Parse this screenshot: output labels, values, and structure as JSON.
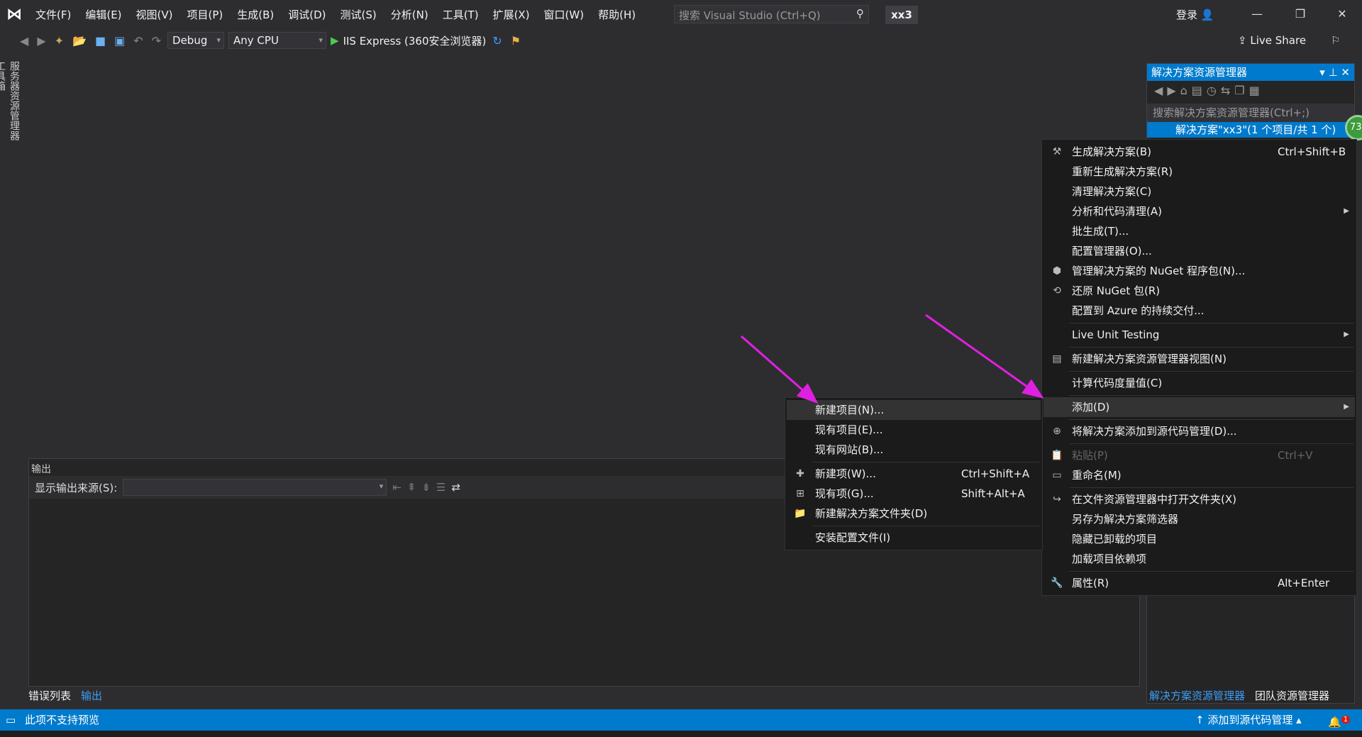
{
  "titlebar": {
    "menus": [
      "文件(F)",
      "编辑(E)",
      "视图(V)",
      "项目(P)",
      "生成(B)",
      "调试(D)",
      "测试(S)",
      "分析(N)",
      "工具(T)",
      "扩展(X)",
      "窗口(W)",
      "帮助(H)"
    ],
    "search_placeholder": "搜索 Visual Studio (Ctrl+Q)",
    "project": "xx3",
    "login": "登录"
  },
  "toolbar": {
    "config": "Debug",
    "platform": "Any CPU",
    "run": "IIS Express (360安全浏览器)",
    "live_share": "Live Share"
  },
  "left_tabs": [
    "服务器资源管理器",
    "工具箱"
  ],
  "solution_explorer": {
    "title": "解决方案资源管理器",
    "search_placeholder": "搜索解决方案资源管理器(Ctrl+;)",
    "root": "解决方案\"xx3\"(1 个项目/共 1 个)",
    "badge": "73",
    "tabs": [
      "解决方案资源管理器",
      "团队资源管理器"
    ]
  },
  "output": {
    "title": "输出",
    "source_label": "显示输出来源(S):"
  },
  "bottom_tabs": [
    "错误列表",
    "输出"
  ],
  "status": {
    "left": "此项不支持预览",
    "source_control": "添加到源代码管理",
    "notifications": "1"
  },
  "context_menu": [
    {
      "label": "生成解决方案(B)",
      "shortcut": "Ctrl+Shift+B",
      "icon": "build-icon"
    },
    {
      "label": "重新生成解决方案(R)"
    },
    {
      "label": "清理解决方案(C)"
    },
    {
      "label": "分析和代码清理(A)",
      "submenu": true
    },
    {
      "label": "批生成(T)..."
    },
    {
      "label": "配置管理器(O)..."
    },
    {
      "label": "管理解决方案的 NuGet 程序包(N)...",
      "icon": "nuget-icon"
    },
    {
      "label": "还原 NuGet 包(R)",
      "icon": "restore-icon"
    },
    {
      "label": "配置到 Azure 的持续交付..."
    },
    {
      "sep": true
    },
    {
      "label": "Live Unit Testing",
      "submenu": true
    },
    {
      "sep": true
    },
    {
      "label": "新建解决方案资源管理器视图(N)",
      "icon": "new-view-icon"
    },
    {
      "sep": true
    },
    {
      "label": "计算代码度量值(C)"
    },
    {
      "sep": true
    },
    {
      "label": "添加(D)",
      "submenu": true,
      "highlight": true
    },
    {
      "sep": true
    },
    {
      "label": "将解决方案添加到源代码管理(D)...",
      "icon": "source-control-icon"
    },
    {
      "sep": true
    },
    {
      "label": "粘贴(P)",
      "shortcut": "Ctrl+V",
      "disabled": true,
      "icon": "paste-icon"
    },
    {
      "label": "重命名(M)",
      "icon": "rename-icon"
    },
    {
      "sep": true
    },
    {
      "label": "在文件资源管理器中打开文件夹(X)",
      "icon": "open-folder-icon"
    },
    {
      "label": "另存为解决方案筛选器"
    },
    {
      "label": "隐藏已卸载的项目"
    },
    {
      "label": "加载项目依赖项"
    },
    {
      "sep": true
    },
    {
      "label": "属性(R)",
      "shortcut": "Alt+Enter",
      "icon": "wrench-icon"
    }
  ],
  "add_submenu": [
    {
      "label": "新建项目(N)...",
      "highlight": true
    },
    {
      "label": "现有项目(E)..."
    },
    {
      "label": "现有网站(B)..."
    },
    {
      "sep": true
    },
    {
      "label": "新建项(W)...",
      "shortcut": "Ctrl+Shift+A",
      "icon": "new-item-icon"
    },
    {
      "label": "现有项(G)...",
      "shortcut": "Shift+Alt+A",
      "icon": "existing-item-icon"
    },
    {
      "label": "新建解决方案文件夹(D)",
      "icon": "new-folder-icon"
    },
    {
      "sep": true
    },
    {
      "label": "安装配置文件(I)"
    }
  ],
  "colors": {
    "accent": "#007acc",
    "arrow": "#e020e0",
    "background": "#2d2d30"
  }
}
